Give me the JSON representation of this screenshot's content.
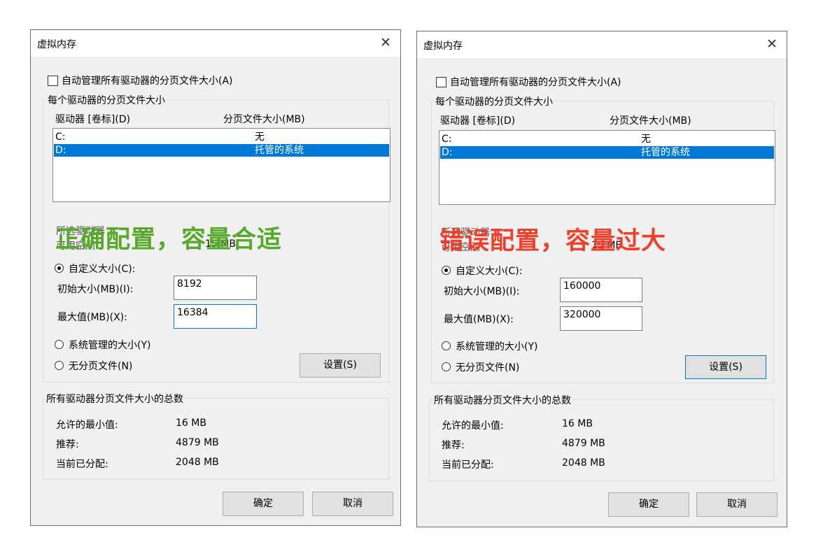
{
  "colors": {
    "good_label": "#57a92a",
    "bad_label": "#ef3e2a",
    "selection": "#0078d7"
  },
  "left": {
    "title": "虚拟内存",
    "auto_manage_label": "自动管理所有驱动器的分页文件大小(A)",
    "group_title": "每个驱动器的分页文件大小",
    "col_drive": "驱动器 [卷标](D)",
    "col_size": "分页文件大小(MB)",
    "drives": [
      {
        "drive": "C:",
        "size": "无"
      },
      {
        "drive": "D:",
        "size": "托管的系统"
      }
    ],
    "partial_line1": "所选驱动器",
    "partial_line2": "可用空间",
    "partial_value": "15 MB",
    "overlay_label": "正确配置，容量合适",
    "custom_size_label": "自定义大小(C):",
    "initial_size_label": "初始大小(MB)(I):",
    "initial_size_value": "8192",
    "max_size_label": "最大值(MB)(X):",
    "max_size_value": "16384",
    "system_managed_label": "系统管理的大小(Y)",
    "no_paging_label": "无分页文件(N)",
    "set_button": "设置(S)",
    "totals_title": "所有驱动器分页文件大小的总数",
    "min_allowed_label": "允许的最小值:",
    "min_allowed_value": "16 MB",
    "recommended_label": "推荐:",
    "recommended_value": "4879 MB",
    "current_label": "当前已分配:",
    "current_value": "2048 MB",
    "ok_button": "确定",
    "cancel_button": "取消"
  },
  "right": {
    "title": "虚拟内存",
    "auto_manage_label": "自动管理所有驱动器的分页文件大小(A)",
    "group_title": "每个驱动器的分页文件大小",
    "col_drive": "驱动器 [卷标](D)",
    "col_size": "分页文件大小(MB)",
    "drives": [
      {
        "drive": "C:",
        "size": "无"
      },
      {
        "drive": "D:",
        "size": "托管的系统"
      }
    ],
    "partial_line1": "所选驱动器",
    "partial_line2": "可用空间",
    "partial_value": "15 MB",
    "overlay_label": "错误配置，容量过大",
    "custom_size_label": "自定义大小(C):",
    "initial_size_label": "初始大小(MB)(I):",
    "initial_size_value": "160000",
    "max_size_label": "最大值(MB)(X):",
    "max_size_value": "320000",
    "system_managed_label": "系统管理的大小(Y)",
    "no_paging_label": "无分页文件(N)",
    "set_button": "设置(S)",
    "totals_title": "所有驱动器分页文件大小的总数",
    "min_allowed_label": "允许的最小值:",
    "min_allowed_value": "16 MB",
    "recommended_label": "推荐:",
    "recommended_value": "4879 MB",
    "current_label": "当前已分配:",
    "current_value": "2048 MB",
    "ok_button": "确定",
    "cancel_button": "取消"
  }
}
